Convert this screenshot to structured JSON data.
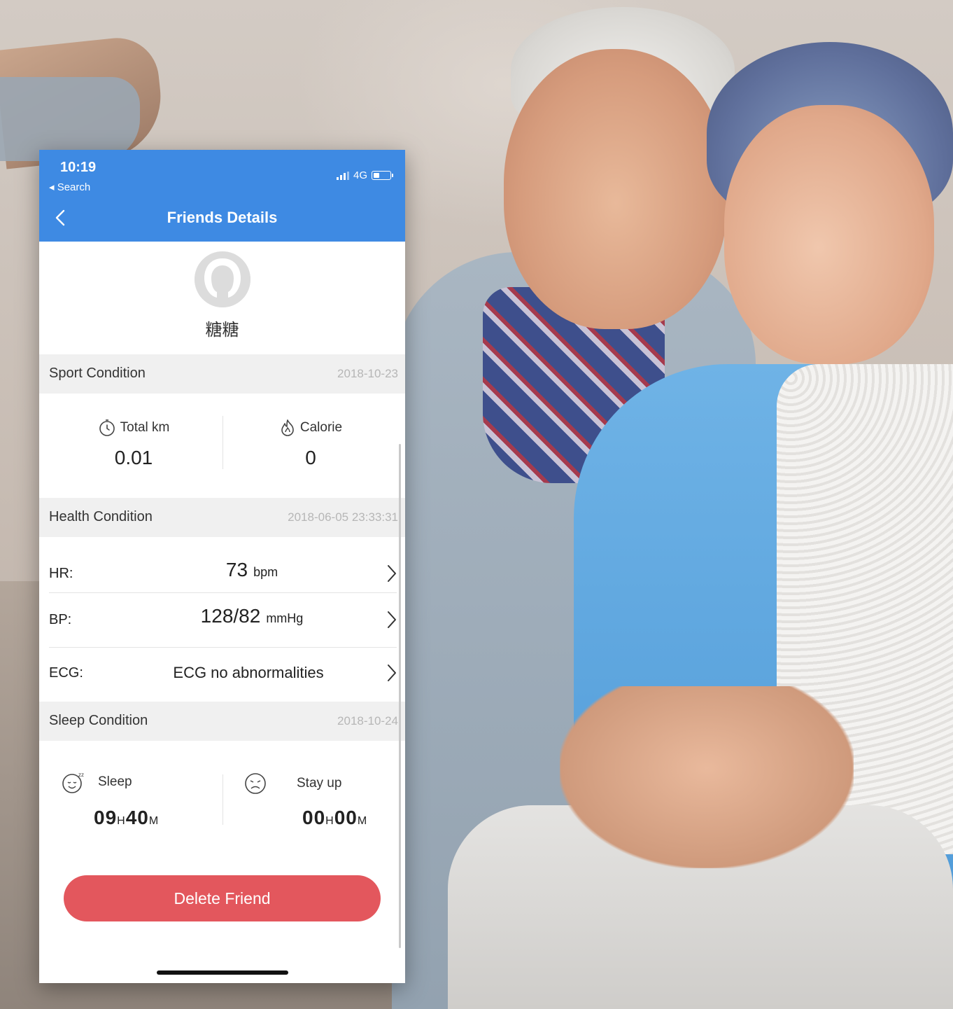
{
  "status": {
    "time": "10:19",
    "back_label": "◂ Search",
    "network": "4G"
  },
  "header": {
    "title": "Friends Details"
  },
  "profile": {
    "name": "糖糖"
  },
  "sport": {
    "label": "Sport Condition",
    "date": "2018-10-23",
    "total_km_label": "Total km",
    "total_km_value": "0.01",
    "calorie_label": "Calorie",
    "calorie_value": "0"
  },
  "health": {
    "label": "Health Condition",
    "date": "2018-06-05 23:33:31",
    "rows": [
      {
        "label": "HR:",
        "value": "73",
        "unit": "bpm"
      },
      {
        "label": "BP:",
        "value": "128/82",
        "unit": "mmHg"
      },
      {
        "label": "ECG:",
        "text": "ECG no abnormalities"
      }
    ]
  },
  "sleep": {
    "label": "Sleep Condition",
    "date": "2018-10-24",
    "sleep_label": "Sleep",
    "sleep_hours": "09",
    "sleep_minutes": "40",
    "stayup_label": "Stay up",
    "stayup_hours": "00",
    "stayup_minutes": "00",
    "hour_unit": "H",
    "minute_unit": "M"
  },
  "actions": {
    "delete_label": "Delete Friend"
  },
  "colors": {
    "header": "#3e8ae3",
    "delete": "#e3575d"
  },
  "icons": [
    "back-chevron-icon",
    "signal-icon",
    "battery-icon",
    "avatar-icon",
    "stopwatch-icon",
    "flame-icon",
    "chevron-right-icon",
    "sleep-face-icon",
    "tired-face-icon"
  ]
}
